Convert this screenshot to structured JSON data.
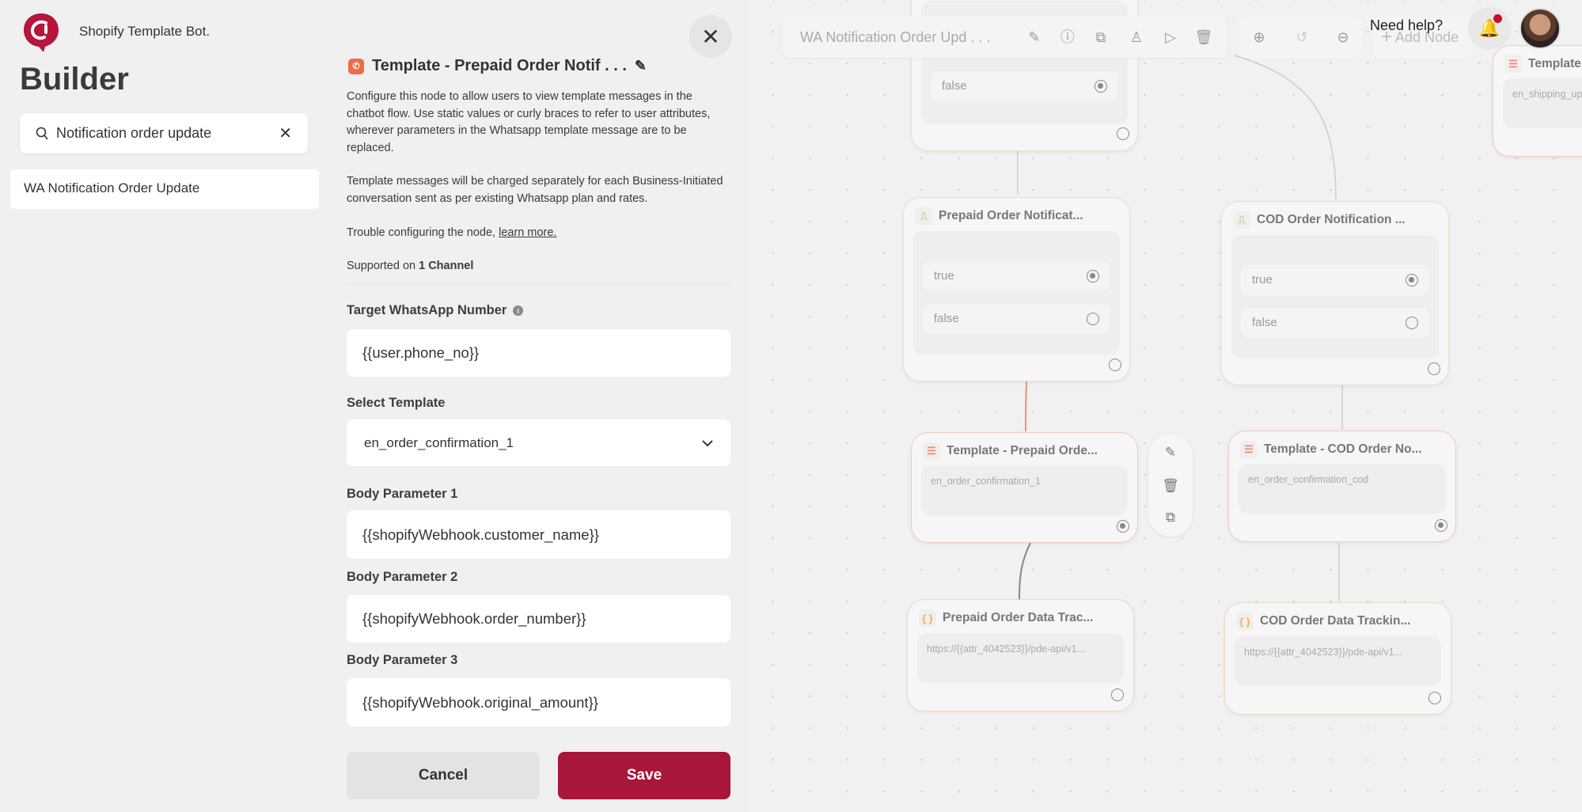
{
  "app": {
    "bot_name": "Shopify Template Bot.",
    "title": "Builder",
    "brand_color": "#b5163a"
  },
  "sidebar": {
    "search": {
      "value": "Notification order update",
      "icon": "search-icon",
      "clear_icon": "close-icon"
    },
    "items": [
      {
        "label": "WA Notification Order Update"
      }
    ]
  },
  "panel": {
    "title": "Template - Prepaid Order Notif . . .",
    "description_1": "Configure this node to allow users to view template messages in the chatbot flow. Use static values or curly braces to refer to user attributes, wherever parameters in the Whatsapp template message are to be replaced.",
    "description_2": "Template messages will be charged separately for each Business-Initiated conversation sent as per existing Whatsapp plan and rates.",
    "trouble_text": "Trouble configuring the node, ",
    "learn_more": "learn more.",
    "supported_prefix": "Supported on ",
    "supported_channels": "1 Channel",
    "fields": {
      "target_label": "Target WhatsApp Number",
      "target_value": "{{user.phone_no}}",
      "template_label": "Select Template",
      "template_value": "en_order_confirmation_1",
      "body1_label": "Body Parameter 1",
      "body1_value": "{{shopifyWebhook.customer_name}}",
      "body2_label": "Body Parameter 2",
      "body2_value": "{{shopifyWebhook.order_number}}",
      "body3_label": "Body Parameter 3",
      "body3_value": "{{shopifyWebhook.original_amount}}"
    },
    "cancel_label": "Cancel",
    "save_label": "Save",
    "save_color": "#a8163a"
  },
  "toolbar": {
    "flow_name": "WA Notification Order Upd . . .",
    "add_node": "Add Node",
    "need_help": "Need help?"
  },
  "nodes": {
    "top": {
      "row_false": "false"
    },
    "prepaid_cond": {
      "title": "Prepaid Order Notificat...",
      "row_true": "true",
      "row_false": "false"
    },
    "cod_cond": {
      "title": "COD Order Notification ...",
      "row_true": "true",
      "row_false": "false"
    },
    "prepaid_tpl": {
      "title": "Template - Prepaid Orde...",
      "text": "en_order_confirmation_1"
    },
    "cod_tpl": {
      "title": "Template - COD Order No...",
      "text": "en_order_confirmation_cod"
    },
    "prepaid_data": {
      "title": "Prepaid Order Data Trac...",
      "text": "https://{{attr_4042523}}/pde-api/v1..."
    },
    "cod_data": {
      "title": "COD Order Data Trackin...",
      "text": "https://{{attr_4042523}}/pde-api/v1..."
    },
    "right_tpl": {
      "title": "Template",
      "text": "en_shipping_up"
    }
  }
}
